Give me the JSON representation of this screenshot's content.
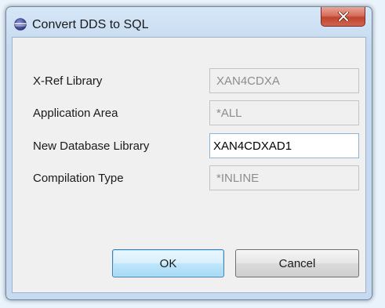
{
  "window": {
    "title": "Convert DDS to SQL",
    "close_label": "×"
  },
  "form": {
    "rows": [
      {
        "label": "X-Ref Library",
        "value": "XAN4CDXA",
        "editable": false
      },
      {
        "label": "Application Area",
        "value": "*ALL",
        "editable": false
      },
      {
        "label": "New Database Library",
        "value": "XAN4CDXAD1",
        "editable": true
      },
      {
        "label": "Compilation Type",
        "value": "*INLINE",
        "editable": false
      }
    ]
  },
  "buttons": {
    "ok_label": "OK",
    "cancel_label": "Cancel"
  },
  "colors": {
    "close_button": "#c0442e",
    "default_button_border": "#3c7fb1",
    "disabled_text": "#8d8d8d"
  }
}
